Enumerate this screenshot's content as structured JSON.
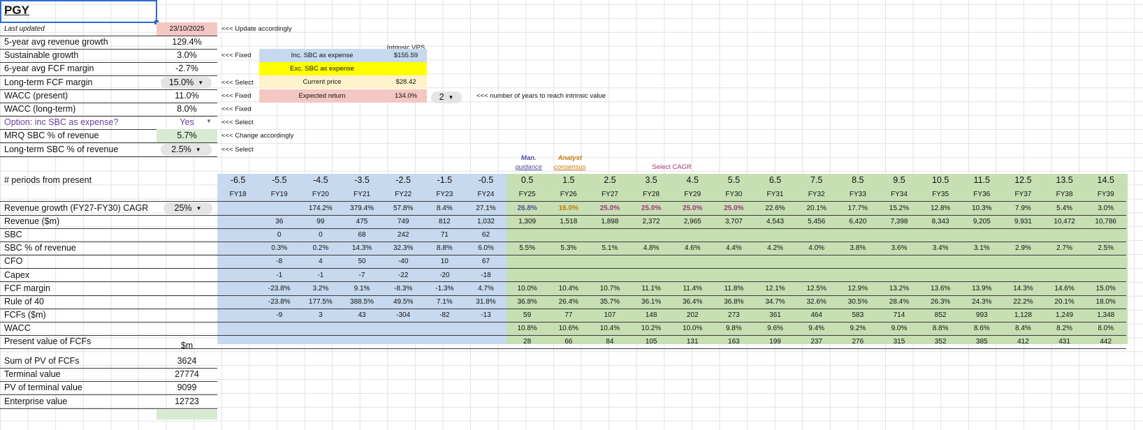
{
  "colors": {
    "blue": "#c6d9ef",
    "green": "#c6e0b4",
    "yellow": "#ffff00",
    "peach": "#fff2cc",
    "pink": "#f4c7c3",
    "green_light": "#d9ead3",
    "grid": "#e2e2e2",
    "selection": "#2a6bd1"
  },
  "ticker": "PGY",
  "last_updated": {
    "label": "Last updated",
    "value": "23/10/2025",
    "note": "<<< Update accordingly"
  },
  "params": [
    {
      "label": "5-year avg revenue growth",
      "value": "129.4%",
      "note": ""
    },
    {
      "label": "Sustainable growth",
      "value": "3.0%",
      "note": "<<< Fixed"
    },
    {
      "label": "6-year avg FCF margin",
      "value": "-2.7%",
      "note": ""
    },
    {
      "label": "Long-term FCF margin",
      "value": "15.0%",
      "note": "<<< Select"
    },
    {
      "label": "WACC (present)",
      "value": "11.0%",
      "note": "<<< Fixed"
    },
    {
      "label": "WACC (long-term)",
      "value": "8.0%",
      "note": "<<< Fixed"
    },
    {
      "label": "Option: inc SBC as expense?",
      "value": "Yes",
      "note": "<<< Select"
    },
    {
      "label": "MRQ SBC % of revenue",
      "value": "5.7%",
      "note": "<<< Change accordingly"
    },
    {
      "label": "Long-term SBC % of revenue",
      "value": "2.5%",
      "note": "<<< Select"
    }
  ],
  "intrinsic": {
    "header": "Intrinsic VPS",
    "rows": [
      {
        "label": "Inc. SBC as expense",
        "value": "$155.59"
      },
      {
        "label": "Exc. SBC as expense",
        "value": ""
      },
      {
        "label": "Current price",
        "value": "$28.42"
      },
      {
        "label": "Expected return",
        "value": "134.0%"
      }
    ],
    "years_select": "2",
    "years_note": "<<< number of years to reach intrinsic value"
  },
  "headers": {
    "man_guidance_1": "Man.",
    "man_guidance_2": "guidance",
    "analyst_1": "Analyst",
    "analyst_2": "consensus",
    "select_cagr": "Select CAGR"
  },
  "periods_label": "# periods from present",
  "periods": [
    "-6.5",
    "-5.5",
    "-4.5",
    "-3.5",
    "-2.5",
    "-1.5",
    "-0.5",
    "0.5",
    "1.5",
    "2.5",
    "3.5",
    "4.5",
    "5.5",
    "6.5",
    "7.5",
    "8.5",
    "9.5",
    "10.5",
    "11.5",
    "12.5",
    "13.5",
    "14.5"
  ],
  "fiscal_years": [
    "FY18",
    "FY19",
    "FY20",
    "FY21",
    "FY22",
    "FY23",
    "FY24",
    "FY25",
    "FY26",
    "FY27",
    "FY28",
    "FY29",
    "FY30",
    "FY31",
    "FY32",
    "FY33",
    "FY34",
    "FY35",
    "FY36",
    "FY37",
    "FY38",
    "FY39"
  ],
  "cagr_select": "25%",
  "table_rows": [
    {
      "label": "Revenue growth (FY27-FY30) CAGR",
      "values": [
        "",
        "",
        "174.2%",
        "379.4%",
        "57.8%",
        "8.4%",
        "27.1%",
        "26.8%",
        "16.0%",
        "25.0%",
        "25.0%",
        "25.0%",
        "25.0%",
        "22.6%",
        "20.1%",
        "17.7%",
        "15.2%",
        "12.8%",
        "10.3%",
        "7.9%",
        "5.4%",
        "3.0%"
      ]
    },
    {
      "label": "Revenue ($m)",
      "values": [
        "",
        "36",
        "99",
        "475",
        "749",
        "812",
        "1,032",
        "1,309",
        "1,518",
        "1,898",
        "2,372",
        "2,965",
        "3,707",
        "4,543",
        "5,456",
        "6,420",
        "7,398",
        "8,343",
        "9,205",
        "9,931",
        "10,472",
        "10,786"
      ]
    },
    {
      "label": "SBC",
      "values": [
        "",
        "0",
        "0",
        "68",
        "242",
        "71",
        "62",
        "",
        "",
        "",
        "",
        "",
        "",
        "",
        "",
        "",
        "",
        "",
        "",
        "",
        "",
        ""
      ]
    },
    {
      "label": "SBC % of revenue",
      "values": [
        "",
        "0.3%",
        "0.2%",
        "14.3%",
        "32.3%",
        "8.8%",
        "6.0%",
        "5.5%",
        "5.3%",
        "5.1%",
        "4.8%",
        "4.6%",
        "4.4%",
        "4.2%",
        "4.0%",
        "3.8%",
        "3.6%",
        "3.4%",
        "3.1%",
        "2.9%",
        "2.7%",
        "2.5%"
      ]
    },
    {
      "label": "CFO",
      "values": [
        "",
        "-8",
        "4",
        "50",
        "-40",
        "10",
        "67",
        "",
        "",
        "",
        "",
        "",
        "",
        "",
        "",
        "",
        "",
        "",
        "",
        "",
        "",
        ""
      ]
    },
    {
      "label": "Capex",
      "values": [
        "",
        "-1",
        "-1",
        "-7",
        "-22",
        "-20",
        "-18",
        "",
        "",
        "",
        "",
        "",
        "",
        "",
        "",
        "",
        "",
        "",
        "",
        "",
        "",
        ""
      ]
    },
    {
      "label": "FCF margin",
      "values": [
        "",
        "-23.8%",
        "3.2%",
        "9.1%",
        "-8.3%",
        "-1.3%",
        "4.7%",
        "10.0%",
        "10.4%",
        "10.7%",
        "11.1%",
        "11.4%",
        "11.8%",
        "12.1%",
        "12.5%",
        "12.9%",
        "13.2%",
        "13.6%",
        "13.9%",
        "14.3%",
        "14.6%",
        "15.0%"
      ]
    },
    {
      "label": "Rule of 40",
      "values": [
        "",
        "-23.8%",
        "177.5%",
        "388.5%",
        "49.5%",
        "7.1%",
        "31.8%",
        "36.8%",
        "26.4%",
        "35.7%",
        "36.1%",
        "36.4%",
        "36.8%",
        "34.7%",
        "32.6%",
        "30.5%",
        "28.4%",
        "26.3%",
        "24.3%",
        "22.2%",
        "20.1%",
        "18.0%"
      ]
    },
    {
      "label": "FCFs ($m)",
      "values": [
        "",
        "-9",
        "3",
        "43",
        "-304",
        "-82",
        "-13",
        "59",
        "77",
        "107",
        "148",
        "202",
        "273",
        "361",
        "464",
        "583",
        "714",
        "852",
        "993",
        "1,128",
        "1,249",
        "1,348"
      ]
    },
    {
      "label": "WACC",
      "values": [
        "",
        "",
        "",
        "",
        "",
        "",
        "",
        "10.8%",
        "10.6%",
        "10.4%",
        "10.2%",
        "10.0%",
        "9.8%",
        "9.6%",
        "9.4%",
        "9.2%",
        "9.0%",
        "8.8%",
        "8.6%",
        "8.4%",
        "8.2%",
        "8.0%"
      ]
    },
    {
      "label": "Present value of FCFs",
      "values": [
        "",
        "",
        "",
        "",
        "",
        "",
        "",
        "28",
        "66",
        "84",
        "105",
        "131",
        "163",
        "199",
        "237",
        "276",
        "315",
        "352",
        "385",
        "412",
        "431",
        "442"
      ]
    }
  ],
  "summary": {
    "unit": "$m",
    "rows": [
      {
        "label": "Sum of PV of FCFs",
        "value": "3624"
      },
      {
        "label": "Terminal value",
        "value": "27774"
      },
      {
        "label": "PV of terminal value",
        "value": "9099"
      },
      {
        "label": "Enterprise value",
        "value": "12723"
      }
    ]
  }
}
